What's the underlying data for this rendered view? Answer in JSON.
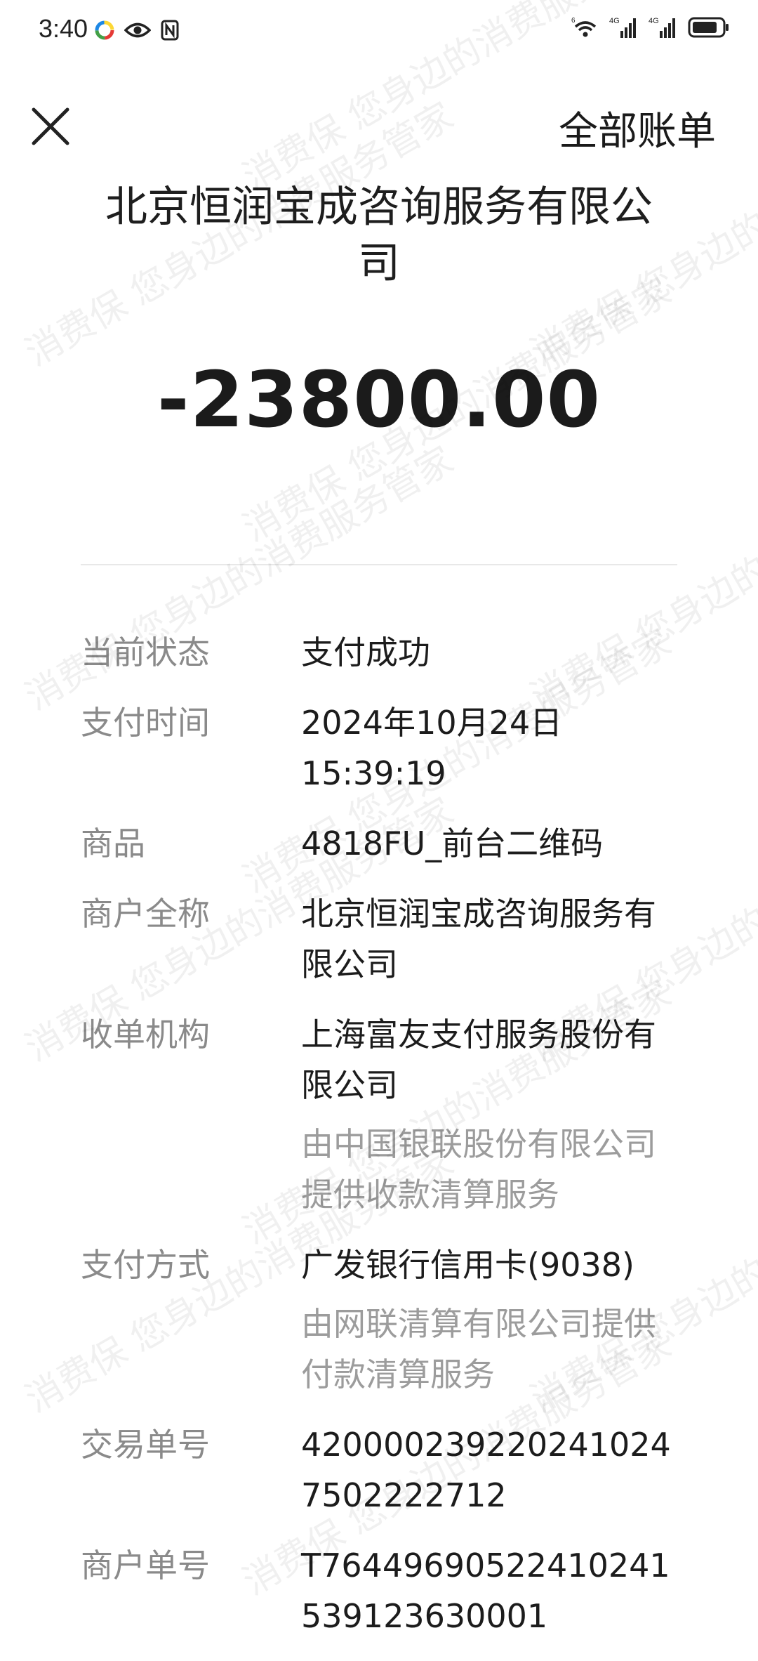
{
  "status_bar": {
    "time": "3:40",
    "icons": [
      "colorful-app-icon",
      "eye-icon",
      "nfc-icon",
      "wifi-icon",
      "signal-4g-1-icon",
      "signal-4g-2-icon",
      "battery-icon"
    ],
    "network_1": "4G",
    "network_2": "4G"
  },
  "header": {
    "close_icon": "close-icon",
    "all_bills": "全部账单"
  },
  "merchant_title": "北京恒润宝成咨询服务有限公司",
  "amount": "-23800.00",
  "details": [
    {
      "label": "当前状态",
      "value": "支付成功",
      "sub": ""
    },
    {
      "label": "支付时间",
      "value": "2024年10月24日 15:39:19",
      "sub": ""
    },
    {
      "label": "商品",
      "value": "4818FU_前台二维码",
      "sub": ""
    },
    {
      "label": "商户全称",
      "value": "北京恒润宝成咨询服务有限公司",
      "sub": ""
    },
    {
      "label": "收单机构",
      "value": "上海富友支付服务股份有限公司",
      "sub": "由中国银联股份有限公司提供收款清算服务"
    },
    {
      "label": "支付方式",
      "value": "广发银行信用卡(9038)",
      "sub": "由网联清算有限公司提供付款清算服务"
    },
    {
      "label": "交易单号",
      "value": "4200002392202410247502222712",
      "sub": ""
    },
    {
      "label": "商户单号",
      "value": "T76449690522410241539123630001",
      "sub": ""
    }
  ],
  "watermark_text": "消费保 您身边的消费服务管家",
  "colors": {
    "text_primary": "#1c1c1c",
    "text_secondary": "#8a8a8a",
    "divider": "#e8e8e8",
    "background": "#ffffff"
  }
}
